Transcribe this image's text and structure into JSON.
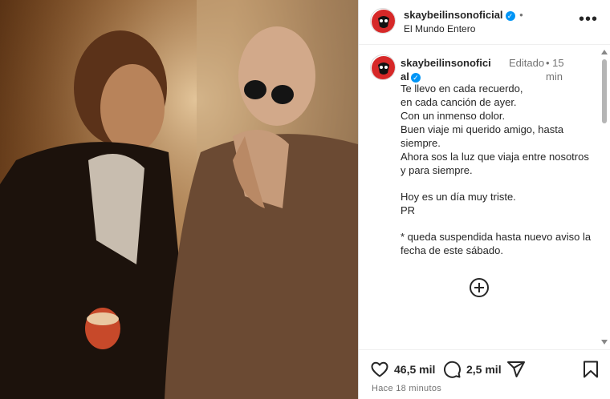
{
  "post": {
    "username": "skaybeilinsonoficial",
    "location": "El Mundo Entero",
    "more_icon": "more-horizontal-icon",
    "image_alt": "photo"
  },
  "caption": {
    "username": "skaybeilinsonoficial",
    "edited": "Editado",
    "time": "15 min",
    "lines": [
      "Te llevo en cada recuerdo,",
      "en cada canción de ayer.",
      "Con un inmenso dolor.",
      "Buen viaje mi querido amigo, hasta siempre.",
      "Ahora sos la luz que viaja entre nosotros y para siempre.",
      "Hoy es un día muy triste.",
      "PR",
      "* queda suspendida hasta nuevo aviso la fecha de este sábado."
    ]
  },
  "actions": {
    "likes": "46,5 mil",
    "comments": "2,5 mil"
  },
  "timestamp": "Hace 18 minutos",
  "colors": {
    "verified": "#0095f6",
    "text": "#262626",
    "muted": "#737373"
  }
}
